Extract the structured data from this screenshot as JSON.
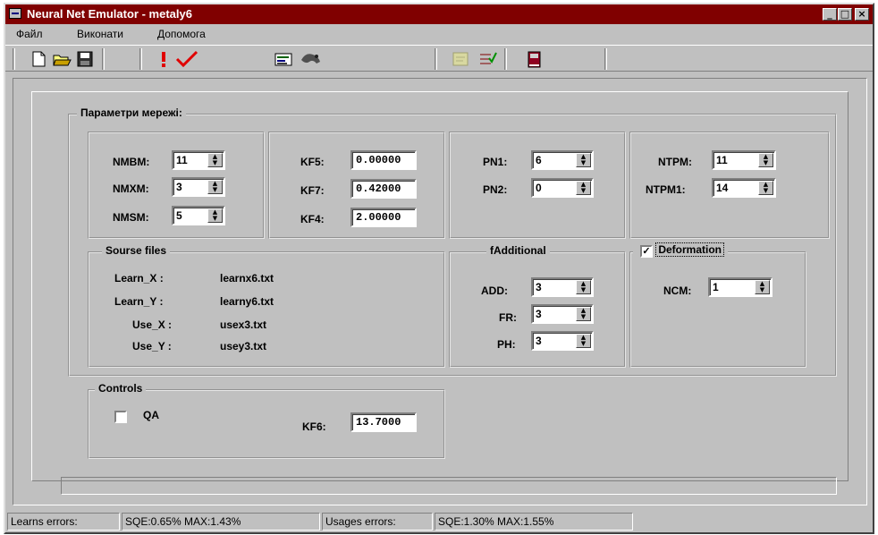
{
  "window": {
    "title": "Neural Net Emulator - metaly6"
  },
  "title_buttons": {
    "minimize": "_",
    "maximize": "□",
    "close": "×"
  },
  "menu": [
    "Файл",
    "Виконати",
    "Допомога"
  ],
  "toolbar_icons": [
    "new-icon",
    "open-icon",
    "save-icon",
    "run-icon",
    "check-icon",
    "chart-icon",
    "animal-icon",
    "disabled-icon",
    "checklist-icon",
    "book-icon"
  ],
  "params": {
    "title": "Параметри мережі:",
    "group1": [
      {
        "label": "NMBM:",
        "value": "11"
      },
      {
        "label": "NMXM:",
        "value": "3"
      },
      {
        "label": "NMSM:",
        "value": "5"
      }
    ],
    "group2": [
      {
        "label": "KF5:",
        "value": "0.00000"
      },
      {
        "label": "KF7:",
        "value": "0.42000"
      },
      {
        "label": "KF4:",
        "value": "2.00000"
      }
    ],
    "group3": [
      {
        "label": "PN1:",
        "value": "6"
      },
      {
        "label": "PN2:",
        "value": "0"
      }
    ],
    "group4": [
      {
        "label": "NTPM:",
        "value": "11"
      },
      {
        "label": "NTPM1:",
        "value": "14"
      }
    ]
  },
  "source_files": {
    "title": "Sourse files",
    "rows": [
      {
        "label": "Learn_X :",
        "value": "learnx6.txt"
      },
      {
        "label": "Learn_Y :",
        "value": "learny6.txt"
      },
      {
        "label": "Use_X :",
        "value": "usex3.txt"
      },
      {
        "label": "Use_Y :",
        "value": "usey3.txt"
      }
    ]
  },
  "additional": {
    "title": "fAdditional",
    "rows": [
      {
        "label": "ADD:",
        "value": "3"
      },
      {
        "label": "FR:",
        "value": "3"
      },
      {
        "label": "PH:",
        "value": "3"
      }
    ]
  },
  "deformation": {
    "title": "Deformation",
    "checked": true,
    "ncm_label": "NCM:",
    "ncm_value": "1"
  },
  "controls": {
    "title": "Controls",
    "qa_label": "QA",
    "qa_checked": false,
    "kf6_label": "KF6:",
    "kf6_value": "13.7000"
  },
  "status": {
    "learns_label": "Learns errors:",
    "learns_value": "SQE:0.65%  MAX:1.43%",
    "usages_label": "Usages errors:",
    "usages_value": "SQE:1.30%  MAX:1.55%"
  }
}
